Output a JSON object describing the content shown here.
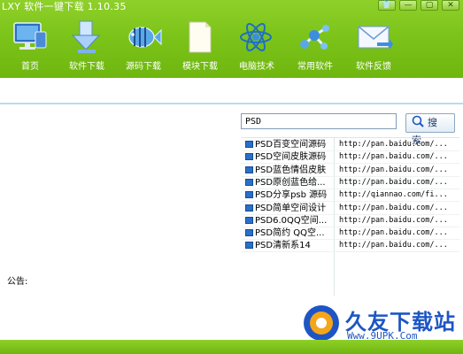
{
  "window": {
    "title": "LXY 软件一键下载 1.10.35",
    "controls": [
      "shirt-icon",
      "minimize-icon",
      "maximize-icon",
      "close-icon"
    ]
  },
  "nav": [
    {
      "label": "首页",
      "icon": "monitor-icon"
    },
    {
      "label": "软件下载",
      "icon": "download-arrow-icon"
    },
    {
      "label": "源码下载",
      "icon": "fish-icon"
    },
    {
      "label": "模块下载",
      "icon": "document-icon"
    },
    {
      "label": "电脑技术",
      "icon": "atom-icon"
    },
    {
      "label": "常用软件",
      "icon": "molecule-icon"
    },
    {
      "label": "软件反馈",
      "icon": "envelope-icon"
    }
  ],
  "search": {
    "value": "PSD",
    "button_label": "搜 索"
  },
  "results": [
    {
      "name": "PSD百变空间源码",
      "url": "http://pan.baidu.com/..."
    },
    {
      "name": "PSD空间皮肤源码",
      "url": "http://pan.baidu.com/..."
    },
    {
      "name": "PSD蓝色情侣皮肤",
      "url": "http://pan.baidu.com/..."
    },
    {
      "name": "PSD原创蓝色给...",
      "url": "http://pan.baidu.com/..."
    },
    {
      "name": "PSD分享psb 源码",
      "url": "http://qiannao.com/fi..."
    },
    {
      "name": "PSD简单空间设计",
      "url": "http://pan.baidu.com/..."
    },
    {
      "name": "PSD6.0QQ空间...",
      "url": "http://pan.baidu.com/..."
    },
    {
      "name": "PSD简约 QQ空...",
      "url": "http://pan.baidu.com/..."
    },
    {
      "name": "PSD清新系14",
      "url": "http://pan.baidu.com/..."
    }
  ],
  "notice": {
    "label": "公告:"
  },
  "watermark": {
    "text": "久友下载站",
    "url": "Www.9UPK.Com"
  },
  "colors": {
    "toolbar_green": "#7cc41a",
    "accent_blue": "#1d56c4"
  }
}
